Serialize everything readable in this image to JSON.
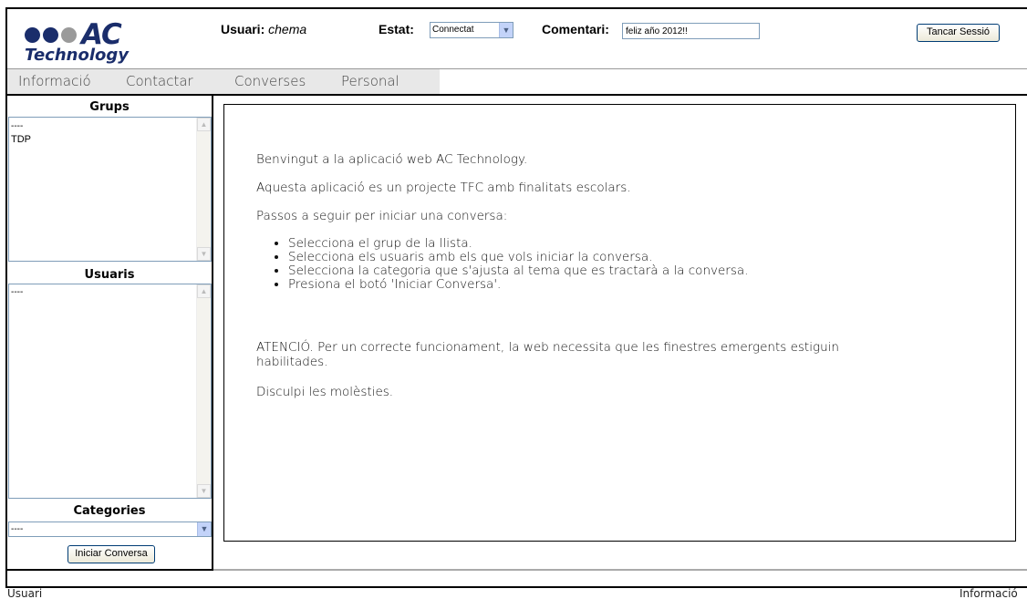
{
  "brand": {
    "logo_main": "AC",
    "logo_sub": "Technology",
    "dot_colors": [
      "#1a2d6b",
      "#1a2d6b",
      "#9a9a9a"
    ]
  },
  "header": {
    "user_label": "Usuari:",
    "user_value": "chema",
    "status_label": "Estat:",
    "status_value": "Connectat",
    "comment_label": "Comentari:",
    "comment_value": "feliz año 2012!!",
    "logout_label": "Tancar Sessió"
  },
  "tabs": [
    {
      "label": "Informació"
    },
    {
      "label": "Contactar"
    },
    {
      "label": "Converses"
    },
    {
      "label": "Personal"
    }
  ],
  "sidebar": {
    "groups_title": "Grups",
    "groups_items": [
      "----",
      "TDP"
    ],
    "users_title": "Usuaris",
    "users_items": [
      "----"
    ],
    "categories_title": "Categories",
    "category_value": "----",
    "start_button": "Iniciar Conversa"
  },
  "main": {
    "welcome": "Benvingut a la aplicació web AC Technology.",
    "about": "Aquesta aplicació es un projecte TFC amb finalitats escolars.",
    "steps_intro": "Passos a seguir per iniciar una conversa:",
    "steps": [
      "Selecciona el grup de la llista.",
      "Selecciona els usuaris amb els que vols iniciar la conversa.",
      "Selecciona la categoria que s'ajusta al tema que es tractarà a la conversa.",
      "Presiona el botó 'Iniciar Conversa'."
    ],
    "warning_line1": "ATENCIÓ. Per un correcte funcionament, la web necessita que les finestres emergents estiguin",
    "warning_line2": "habilitades.",
    "apology": "Disculpi les molèsties."
  },
  "footer": {
    "left": "Usuari",
    "right": "Informació"
  },
  "colors": {
    "brand_navy": "#1a2d6b",
    "tab_bg": "#e8e8e8",
    "input_border": "#7f9db9",
    "button_border": "#003c74"
  }
}
